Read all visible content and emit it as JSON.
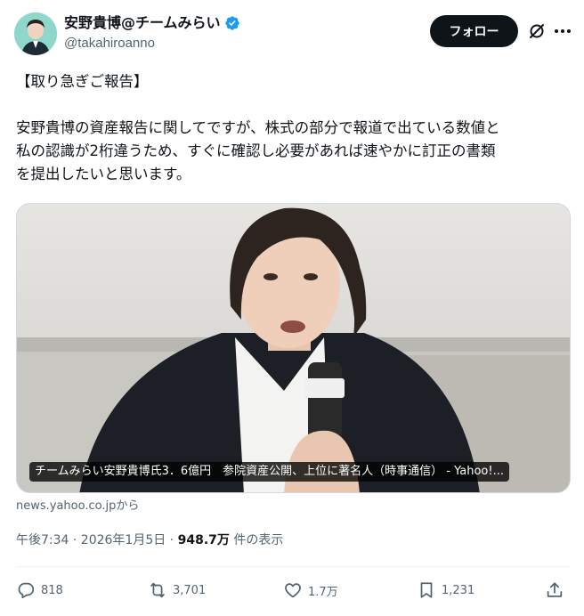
{
  "author": {
    "display_name": "安野貴博@チームみらい",
    "handle": "@takahiroanno",
    "verified": true
  },
  "header": {
    "follow_label": "フォロー",
    "grok_icon": "grok-slash-icon",
    "more_icon": "more-dots-icon"
  },
  "tweet": {
    "line1": "【取り急ぎご報告】",
    "line2": "安野貴博の資産報告に関してですが、株式の部分で報道で出ている数値と",
    "line3": "私の認識が2桁違うため、すぐに確認し必要があれば速やかに訂正の書類",
    "line4": "を提出したいと思います。"
  },
  "media": {
    "caption": "チームみらい安野貴博氏3．6億円　参院資産公開、上位に著名人（時事通信） - Yahoo!...",
    "source": "news.yahoo.co.jpから"
  },
  "meta": {
    "timestamp": "午後7:34 · 2026年1月5日 · ",
    "views_count": "948.7万",
    "views_label": " 件の表示"
  },
  "actions": {
    "replies": "818",
    "reposts": "3,701",
    "likes": "1.7万",
    "bookmarks": "1,231"
  },
  "colors": {
    "text_primary": "#0f1419",
    "text_secondary": "#536471",
    "verified_blue": "#1d9bf0",
    "follow_button_bg": "#0f1419"
  }
}
